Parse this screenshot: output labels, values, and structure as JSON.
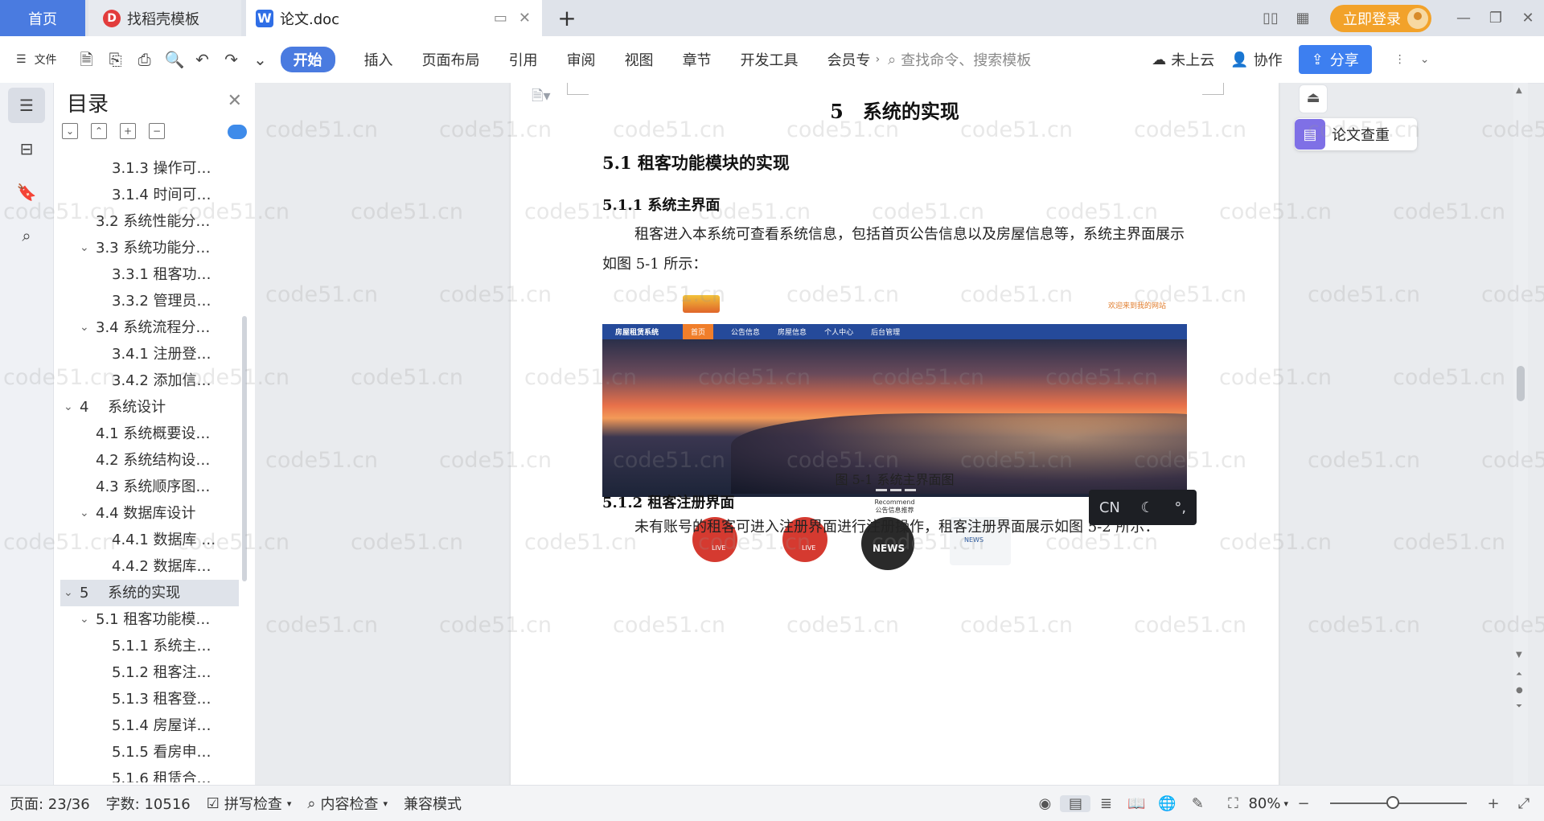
{
  "tabs": {
    "home": "首页",
    "daoke": "找稻壳模板",
    "doc": "论文.doc",
    "new_tab": "+"
  },
  "titlebar": {
    "login": "立即登录"
  },
  "toolbar": {
    "file": "文件",
    "start": "开始",
    "menus": [
      "插入",
      "页面布局",
      "引用",
      "审阅",
      "视图",
      "章节",
      "开发工具",
      "会员专"
    ],
    "search_placeholder": "查找命令、搜索模板",
    "cloud": "未上云",
    "collab": "协作",
    "share": "分享"
  },
  "toc": {
    "title": "目录",
    "items": [
      {
        "label": "3.1.3 操作可…",
        "level": 3
      },
      {
        "label": "3.1.4 时间可…",
        "level": 3
      },
      {
        "label": "3.2 系统性能分…",
        "level": 2
      },
      {
        "label": "3.3 系统功能分…",
        "level": 2,
        "expanded": true
      },
      {
        "label": "3.3.1 租客功…",
        "level": 3
      },
      {
        "label": "3.3.2 管理员…",
        "level": 3
      },
      {
        "label": "3.4 系统流程分…",
        "level": 2,
        "expanded": true
      },
      {
        "label": "3.4.1 注册登…",
        "level": 3
      },
      {
        "label": "3.4.2 添加信…",
        "level": 3
      },
      {
        "label": "4 　系统设计",
        "level": 1,
        "expanded": true
      },
      {
        "label": "4.1 系统概要设…",
        "level": 2
      },
      {
        "label": "4.2 系统结构设…",
        "level": 2
      },
      {
        "label": "4.3 系统顺序图…",
        "level": 2
      },
      {
        "label": "4.4 数据库设计",
        "level": 2,
        "expanded": true
      },
      {
        "label": "4.4.1 数据库 …",
        "level": 3
      },
      {
        "label": "4.4.2 数据库…",
        "level": 3
      },
      {
        "label": "5 　系统的实现",
        "level": 1,
        "expanded": true,
        "selected": true
      },
      {
        "label": "5.1 租客功能模…",
        "level": 2,
        "expanded": true
      },
      {
        "label": "5.1.1 系统主…",
        "level": 3
      },
      {
        "label": "5.1.2 租客注…",
        "level": 3
      },
      {
        "label": "5.1.3 租客登…",
        "level": 3
      },
      {
        "label": "5.1.4 房屋详…",
        "level": 3
      },
      {
        "label": "5.1.5 看房申…",
        "level": 3
      },
      {
        "label": "5.1.6 租赁合…",
        "level": 3
      }
    ]
  },
  "doc": {
    "h1": "5　系统的实现",
    "h2": "5.1  租客功能模块的实现",
    "h3a": "5.1.1  系统主界面",
    "p1": "租客进入本系统可查看系统信息，包括首页公告信息以及房屋信息等，系统主界面展示如图 5-1 所示：",
    "figure": {
      "welcome": "欢迎来到我的网站",
      "brand": "房屋租赁系统",
      "nav": [
        "首页",
        "公告信息",
        "房屋信息",
        "个人中心",
        "后台管理"
      ],
      "recommend": "Recommend",
      "recommend_sub": "公告信息推荐",
      "icon_labels": [
        "LIVE",
        "LIVE",
        "NEWS",
        "NEWS"
      ]
    },
    "caption": "图 5-1  系统主界面图",
    "h3b": "5.1.2  租客注册界面",
    "p2": "未有账号的租客可进入注册界面进行注册操作，租客注册界面展示如图 5-2 所示："
  },
  "float": {
    "check": "论文查重"
  },
  "ime": {
    "lang": "CN",
    "moon": "☾",
    "punct": "°,"
  },
  "watermark": "code51.cn",
  "status": {
    "page": "页面: 23/36",
    "words": "字数: 10516",
    "spell": "拼写检查",
    "content": "内容检查",
    "compat": "兼容模式",
    "zoom": "80%",
    "zoom_level": 0.46
  }
}
